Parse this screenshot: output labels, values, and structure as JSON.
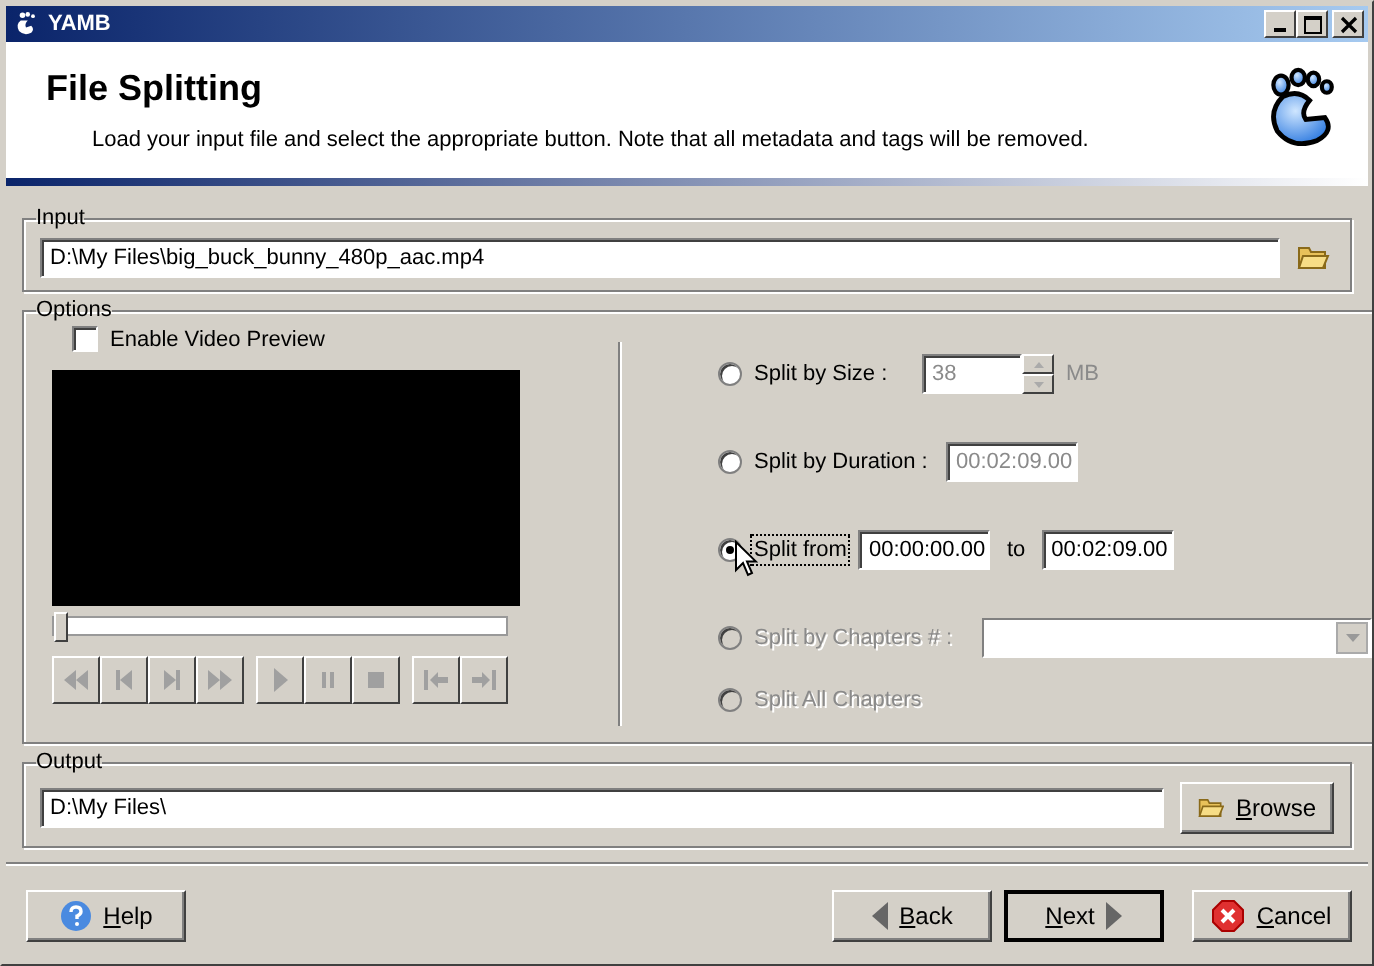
{
  "window": {
    "title": "YAMB"
  },
  "header": {
    "title": "File Splitting",
    "description": "Load your input file and select the appropriate button. Note that all metadata and tags will be removed."
  },
  "input": {
    "legend": "Input",
    "value": "D:\\My Files\\big_buck_bunny_480p_aac.mp4"
  },
  "options": {
    "legend": "Options",
    "preview": {
      "label": "Enable Video Preview",
      "checked": false
    },
    "seek": {
      "level": 0
    },
    "transport": [
      {
        "kind": "rewind",
        "disabled": true
      },
      {
        "kind": "prev",
        "disabled": true
      },
      {
        "kind": "next",
        "disabled": true
      },
      {
        "kind": "forward",
        "disabled": true
      },
      {
        "kind": "play",
        "disabled": true
      },
      {
        "kind": "pause",
        "disabled": true
      },
      {
        "kind": "stop",
        "disabled": true
      },
      {
        "kind": "mark-in",
        "disabled": true
      },
      {
        "kind": "mark-out",
        "disabled": true
      }
    ],
    "modes": [
      {
        "kind": "size",
        "label": "Split by Size :",
        "selected": false,
        "disabled": false,
        "value": "38",
        "unit": "MB",
        "field_disabled": true
      },
      {
        "kind": "duration",
        "label": "Split by Duration :",
        "selected": false,
        "disabled": false,
        "value": "00:02:09.00",
        "field_disabled": true
      },
      {
        "kind": "range",
        "label": "Split from",
        "selected": true,
        "disabled": false,
        "from": "00:00:00.00",
        "joiner": "to",
        "to": "00:02:09.00",
        "field_disabled": false
      },
      {
        "kind": "chapters",
        "label": "Split by Chapters # :",
        "selected": false,
        "disabled": true
      },
      {
        "kind": "all",
        "label": "Split All Chapters",
        "selected": false,
        "disabled": true
      }
    ]
  },
  "output": {
    "legend": "Output",
    "value": "D:\\My Files\\",
    "browse": "Browse"
  },
  "buttons": [
    {
      "kind": "help",
      "label": "Help"
    },
    {
      "kind": "back",
      "label": "Back"
    },
    {
      "kind": "next",
      "label": "Next",
      "default": true
    },
    {
      "kind": "cancel",
      "label": "Cancel"
    }
  ]
}
